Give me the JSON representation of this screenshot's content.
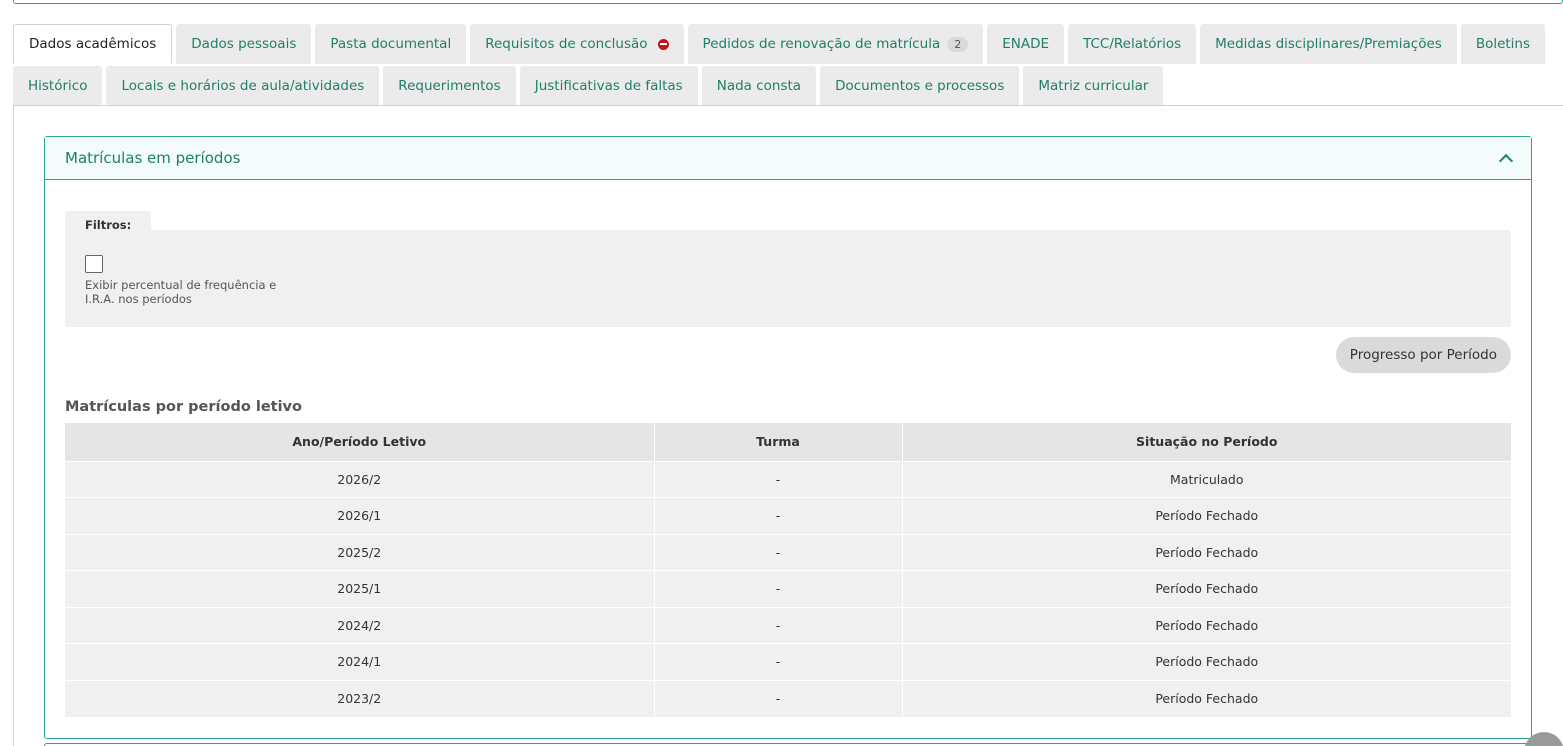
{
  "tabs_row1": [
    {
      "label": "Dados acadêmicos",
      "active": true
    },
    {
      "label": "Dados pessoais"
    },
    {
      "label": "Pasta documental"
    },
    {
      "label": "Requisitos de conclusão",
      "icon": "error-circle-icon"
    },
    {
      "label": "Pedidos de renovação de matrícula",
      "badge": "2"
    },
    {
      "label": "ENADE"
    },
    {
      "label": "TCC/Relatórios"
    },
    {
      "label": "Medidas disciplinares/Premiações"
    },
    {
      "label": "Boletins"
    }
  ],
  "tabs_row2": [
    {
      "label": "Histórico"
    },
    {
      "label": "Locais e horários de aula/atividades"
    },
    {
      "label": "Requerimentos"
    },
    {
      "label": "Justificativas de faltas"
    },
    {
      "label": "Nada consta"
    },
    {
      "label": "Documentos e processos"
    },
    {
      "label": "Matriz curricular"
    }
  ],
  "panel": {
    "title": "Matrículas em períodos",
    "filters": {
      "legend": "Filtros:",
      "checkbox_label": "Exibir percentual de frequência e I.R.A. nos períodos",
      "checked": false
    },
    "progress_button": "Progresso por Período",
    "section_title": "Matrículas por período letivo",
    "table": {
      "headers": [
        "Ano/Período Letivo",
        "Turma",
        "Situação no Período"
      ],
      "rows": [
        [
          "2026/2",
          "-",
          "Matriculado"
        ],
        [
          "2026/1",
          "-",
          "Período Fechado"
        ],
        [
          "2025/2",
          "-",
          "Período Fechado"
        ],
        [
          "2025/1",
          "-",
          "Período Fechado"
        ],
        [
          "2024/2",
          "-",
          "Período Fechado"
        ],
        [
          "2024/1",
          "-",
          "Período Fechado"
        ],
        [
          "2023/2",
          "-",
          "Período Fechado"
        ]
      ]
    }
  },
  "colors": {
    "accent": "#2ba58e",
    "accent_text": "#1f7f6a",
    "error": "#c0151b"
  }
}
